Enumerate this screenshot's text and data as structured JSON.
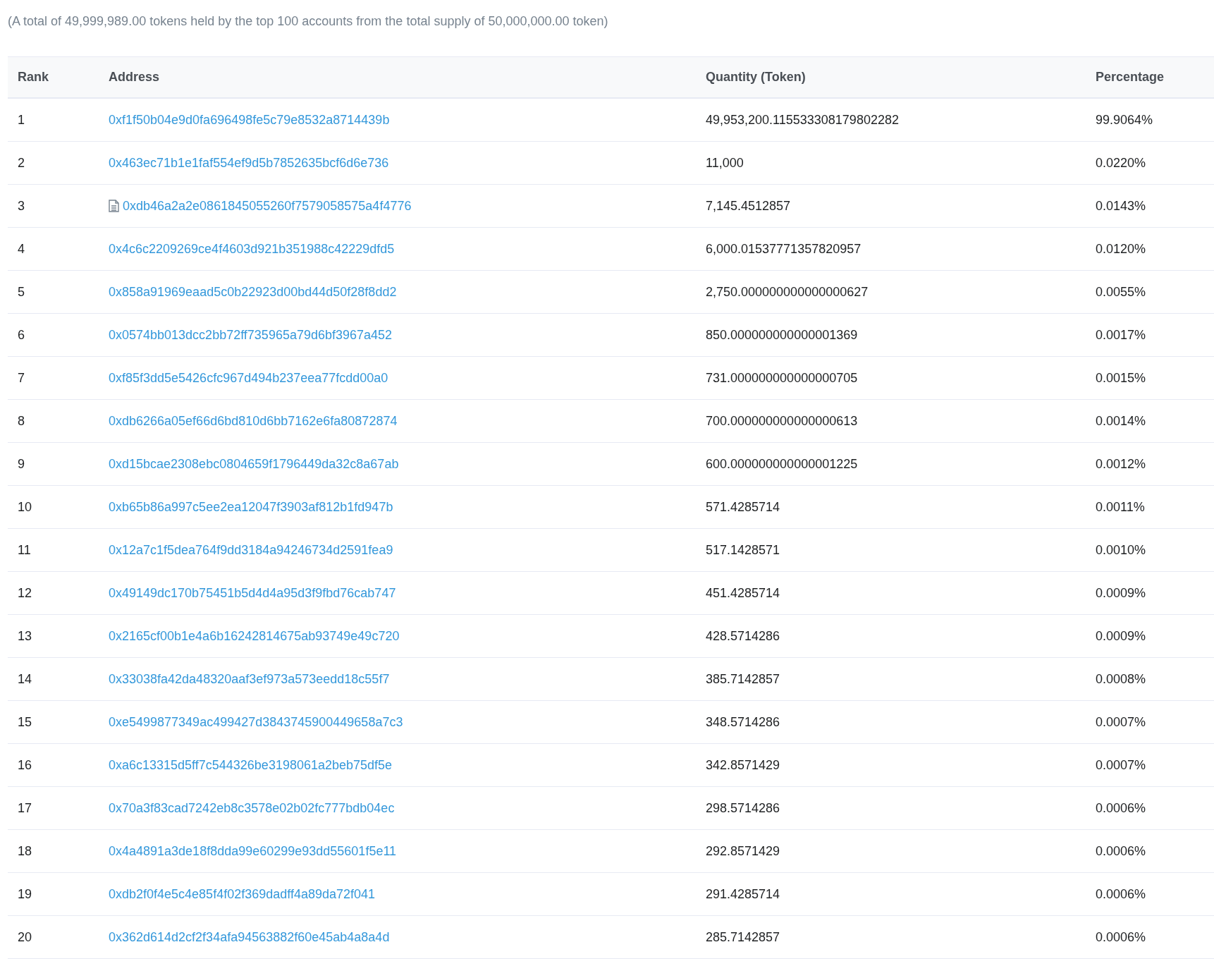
{
  "summary": "(A total of 49,999,989.00 tokens held by the top 100 accounts from the total supply of 50,000,000.00 token)",
  "table": {
    "columns": [
      "Rank",
      "Address",
      "Quantity (Token)",
      "Percentage"
    ],
    "rows": [
      {
        "rank": "1",
        "address": "0xf1f50b04e9d0fa696498fe5c79e8532a8714439b",
        "kind": "account",
        "quantity": "49,953,200.115533308179802282",
        "percentage": "99.9064%"
      },
      {
        "rank": "2",
        "address": "0x463ec71b1e1faf554ef9d5b7852635bcf6d6e736",
        "kind": "account",
        "quantity": "11,000",
        "percentage": "0.0220%"
      },
      {
        "rank": "3",
        "address": "0xdb46a2a2e0861845055260f7579058575a4f4776",
        "kind": "contract",
        "quantity": "7,145.4512857",
        "percentage": "0.0143%"
      },
      {
        "rank": "4",
        "address": "0x4c6c2209269ce4f4603d921b351988c42229dfd5",
        "kind": "account",
        "quantity": "6,000.01537771357820957",
        "percentage": "0.0120%"
      },
      {
        "rank": "5",
        "address": "0x858a91969eaad5c0b22923d00bd44d50f28f8dd2",
        "kind": "account",
        "quantity": "2,750.000000000000000627",
        "percentage": "0.0055%"
      },
      {
        "rank": "6",
        "address": "0x0574bb013dcc2bb72ff735965a79d6bf3967a452",
        "kind": "account",
        "quantity": "850.000000000000001369",
        "percentage": "0.0017%"
      },
      {
        "rank": "7",
        "address": "0xf85f3dd5e5426cfc967d494b237eea77fcdd00a0",
        "kind": "account",
        "quantity": "731.000000000000000705",
        "percentage": "0.0015%"
      },
      {
        "rank": "8",
        "address": "0xdb6266a05ef66d6bd810d6bb7162e6fa80872874",
        "kind": "account",
        "quantity": "700.000000000000000613",
        "percentage": "0.0014%"
      },
      {
        "rank": "9",
        "address": "0xd15bcae2308ebc0804659f1796449da32c8a67ab",
        "kind": "account",
        "quantity": "600.000000000000001225",
        "percentage": "0.0012%"
      },
      {
        "rank": "10",
        "address": "0xb65b86a997c5ee2ea12047f3903af812b1fd947b",
        "kind": "account",
        "quantity": "571.4285714",
        "percentage": "0.0011%"
      },
      {
        "rank": "11",
        "address": "0x12a7c1f5dea764f9dd3184a94246734d2591fea9",
        "kind": "account",
        "quantity": "517.1428571",
        "percentage": "0.0010%"
      },
      {
        "rank": "12",
        "address": "0x49149dc170b75451b5d4d4a95d3f9fbd76cab747",
        "kind": "account",
        "quantity": "451.4285714",
        "percentage": "0.0009%"
      },
      {
        "rank": "13",
        "address": "0x2165cf00b1e4a6b16242814675ab93749e49c720",
        "kind": "account",
        "quantity": "428.5714286",
        "percentage": "0.0009%"
      },
      {
        "rank": "14",
        "address": "0x33038fa42da48320aaf3ef973a573eedd18c55f7",
        "kind": "account",
        "quantity": "385.7142857",
        "percentage": "0.0008%"
      },
      {
        "rank": "15",
        "address": "0xe5499877349ac499427d3843745900449658a7c3",
        "kind": "account",
        "quantity": "348.5714286",
        "percentage": "0.0007%"
      },
      {
        "rank": "16",
        "address": "0xa6c13315d5ff7c544326be3198061a2beb75df5e",
        "kind": "account",
        "quantity": "342.8571429",
        "percentage": "0.0007%"
      },
      {
        "rank": "17",
        "address": "0x70a3f83cad7242eb8c3578e02b02fc777bdb04ec",
        "kind": "account",
        "quantity": "298.5714286",
        "percentage": "0.0006%"
      },
      {
        "rank": "18",
        "address": "0x4a4891a3de18f8dda99e60299e93dd55601f5e11",
        "kind": "account",
        "quantity": "292.8571429",
        "percentage": "0.0006%"
      },
      {
        "rank": "19",
        "address": "0xdb2f0f4e5c4e85f4f02f369dadff4a89da72f041",
        "kind": "account",
        "quantity": "291.4285714",
        "percentage": "0.0006%"
      },
      {
        "rank": "20",
        "address": "0x362d614d2cf2f34afa94563882f60e45ab4a8a4d",
        "kind": "account",
        "quantity": "285.7142857",
        "percentage": "0.0006%"
      }
    ]
  }
}
